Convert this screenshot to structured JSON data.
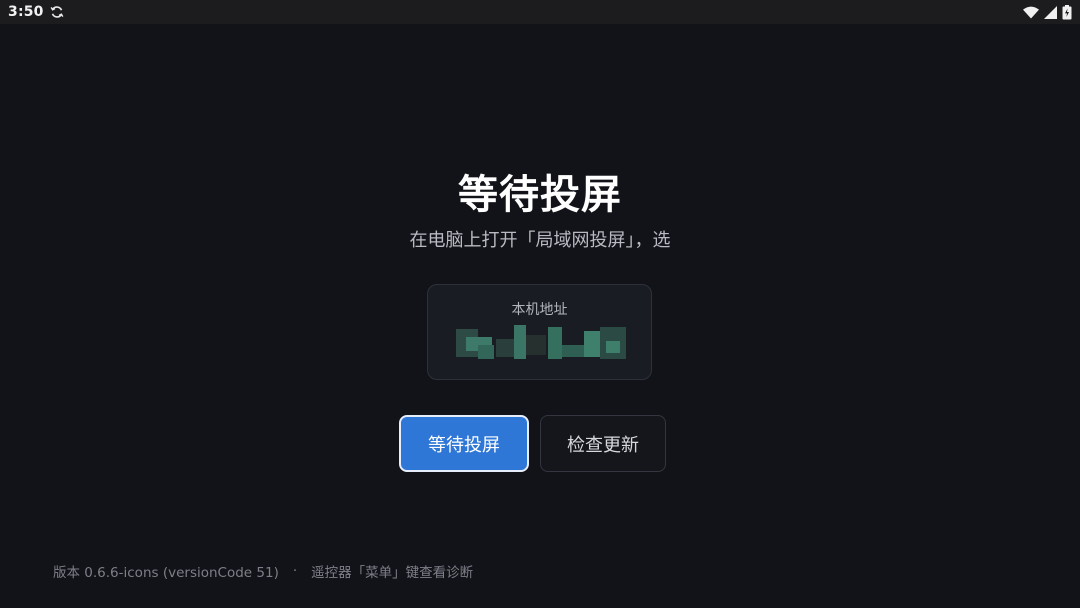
{
  "status_bar": {
    "time": "3:50",
    "icons": [
      "sync-icon",
      "wifi-icon",
      "signal-icon",
      "battery-icon"
    ]
  },
  "main": {
    "title": "等待投屏",
    "subtitle": "在电脑上打开「局域网投屏」，选",
    "address_card": {
      "label": "本机地址",
      "value": ""
    },
    "buttons": {
      "primary_label": "等待投屏",
      "secondary_label": "检查更新"
    }
  },
  "footer": {
    "version": "版本 0.6.6-icons (versionCode 51)",
    "separator": "·",
    "hint": "遥控器「菜单」键查看诊断"
  },
  "colors": {
    "background": "#121318",
    "primary": "#2f77d6",
    "status_bar": "#1c1c1f"
  }
}
